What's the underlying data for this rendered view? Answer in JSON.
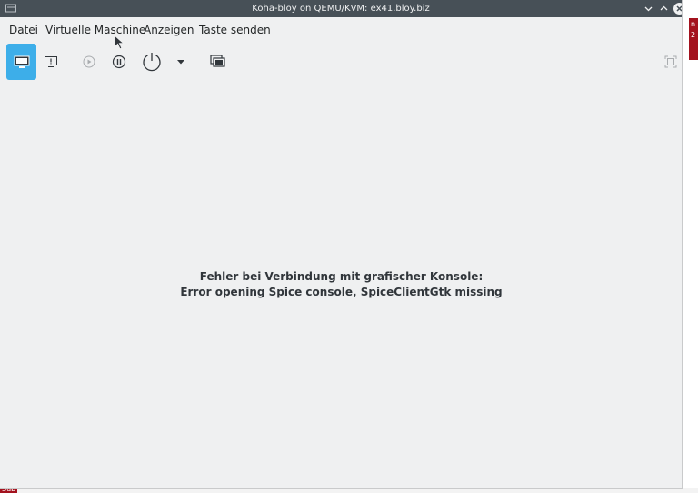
{
  "window": {
    "title": "Koha-bloy on QEMU/KVM: ex41.bloy.biz"
  },
  "menubar": {
    "items": [
      "Datei",
      "Virtuelle Maschine",
      "Anzeigen",
      "Taste senden"
    ]
  },
  "toolbar": {
    "buttons": [
      {
        "icon": "console-display-icon",
        "active": true
      },
      {
        "icon": "vm-details-icon",
        "active": false
      },
      {
        "icon": "play-icon",
        "active": false,
        "disabled": true
      },
      {
        "icon": "pause-icon",
        "active": false
      },
      {
        "icon": "power-icon",
        "active": false
      },
      {
        "icon": "chevron-down-icon",
        "active": false
      },
      {
        "icon": "snapshots-icon",
        "active": false
      },
      {
        "icon": "fullscreen-icon",
        "active": false
      }
    ]
  },
  "console": {
    "error_line1": "Fehler bei Verbindung mit grafischer Konsole:",
    "error_line2": "Error opening Spice console, SpiceClientGtk missing"
  },
  "desktop": {
    "bottom_text": "Sub"
  },
  "colors": {
    "titlebar": "#475057",
    "window_bg": "#eff0f1",
    "accent": "#3daee9",
    "desktop_red": "#a3121e"
  }
}
